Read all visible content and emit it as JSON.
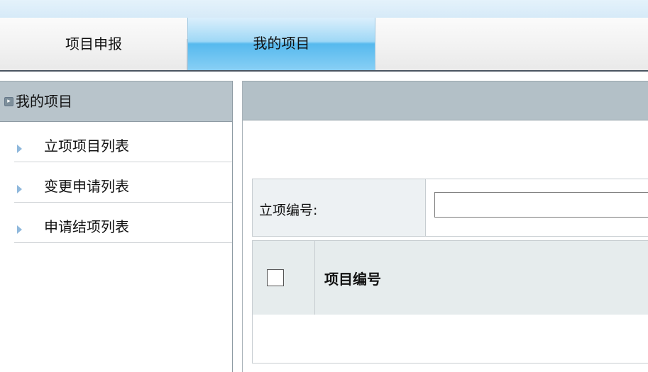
{
  "nav": {
    "tabs": [
      {
        "label": "项目申报"
      },
      {
        "label": "我的项目"
      }
    ]
  },
  "sidebar": {
    "title": "我的项目",
    "items": [
      {
        "label": "立项项目列表"
      },
      {
        "label": "变更申请列表"
      },
      {
        "label": "申请结项列表"
      }
    ]
  },
  "search": {
    "label": "立项编号:",
    "value": "",
    "placeholder": ""
  },
  "table": {
    "columns": [
      "项目编号"
    ],
    "rows": []
  }
}
